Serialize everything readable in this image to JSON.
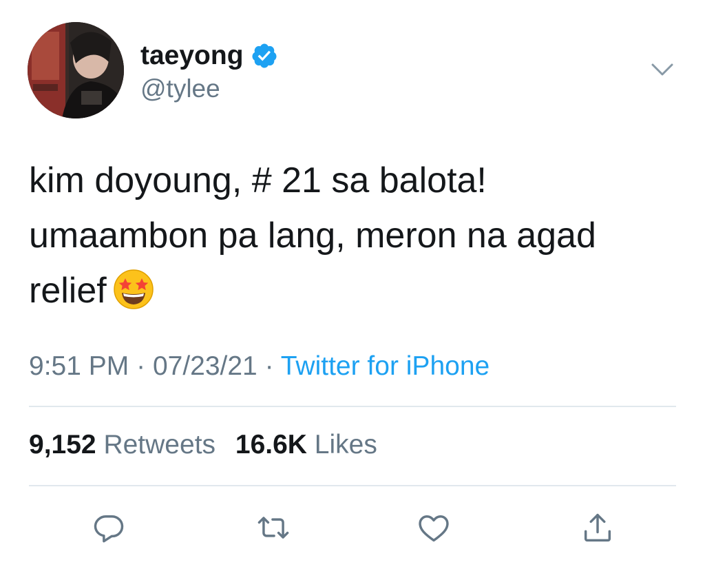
{
  "user": {
    "display_name": "taeyong",
    "handle": "@tylee",
    "verified": true,
    "avatar_icon": "profile-photo"
  },
  "tweet": {
    "lines": [
      "kim doyoung, # 21 sa balota!",
      "umaambon pa lang, meron na agad",
      "relief"
    ],
    "emoji": "star-struck-emoji"
  },
  "meta": {
    "time": "9:51 PM",
    "separator": "·",
    "date": "07/23/21",
    "source": "Twitter for iPhone"
  },
  "stats": {
    "retweets_count": "9,152",
    "retweets_label": "Retweets",
    "likes_count": "16.6K",
    "likes_label": "Likes"
  },
  "actions": [
    "reply-icon",
    "retweet-icon",
    "like-icon",
    "share-icon"
  ],
  "colors": {
    "text": "#14171a",
    "secondary": "#657786",
    "accent": "#1da1f2",
    "divider": "#e1e8ed"
  }
}
